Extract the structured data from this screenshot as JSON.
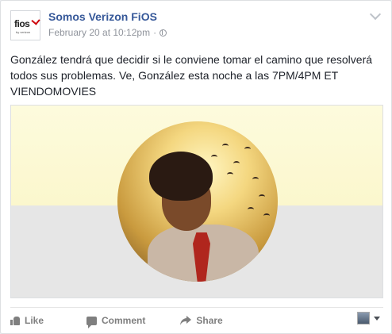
{
  "post": {
    "page_name": "Somos Verizon FiOS",
    "timestamp": "February 20 at 10:12pm",
    "separator": "·",
    "avatar_logo": "fios",
    "avatar_sub": "by verizon",
    "text": "González tendrá que decidir si le conviene tomar el camino que resolverá todos sus problemas. Ve, González esta noche a las 7PM/4PM ET VIENDOMOVIES",
    "privacy_icon": "globe-icon",
    "options_icon": "chevron-down-icon"
  },
  "actions": {
    "like_label": "Like",
    "comment_label": "Comment",
    "share_label": "Share",
    "like_icon": "thumbs-up-icon",
    "comment_icon": "comment-icon",
    "share_icon": "share-arrow-icon"
  },
  "colors": {
    "link": "#365899",
    "meta": "#90949c",
    "brand_red": "#cd040b",
    "media_top": "#fbf7cd",
    "media_bottom": "#e6e6e6"
  }
}
